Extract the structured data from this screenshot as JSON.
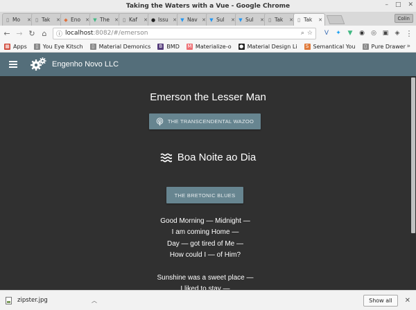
{
  "window": {
    "title": "Taking the Waters with a Vue - Google Chrome",
    "minimize": "–",
    "maximize": "□",
    "close": "✕"
  },
  "tabs": [
    {
      "label": "Mo",
      "fav": "▯",
      "fav_color": "#666666"
    },
    {
      "label": "Tak",
      "fav": "▯",
      "fav_color": "#666666"
    },
    {
      "label": "Eno",
      "fav": "◆",
      "fav_color": "#e0703a"
    },
    {
      "label": "The",
      "fav": "▼",
      "fav_color": "#41b883"
    },
    {
      "label": "Kaf",
      "fav": "▯",
      "fav_color": "#666666"
    },
    {
      "label": "Issu",
      "fav": "●",
      "fav_color": "#222222"
    },
    {
      "label": "Nav",
      "fav": "▼",
      "fav_color": "#2196f3"
    },
    {
      "label": "Sul",
      "fav": "▼",
      "fav_color": "#2196f3"
    },
    {
      "label": "Sul",
      "fav": "▼",
      "fav_color": "#2196f3"
    },
    {
      "label": "Tak",
      "fav": "▯",
      "fav_color": "#666666"
    },
    {
      "label": "Tak",
      "fav": "▯",
      "fav_color": "#666666",
      "active": true
    }
  ],
  "tab_close": "✕",
  "profile_label": "Colin",
  "toolbar": {
    "back": "←",
    "forward": "→",
    "reload": "↻",
    "home": "⌂",
    "url_host": "localhost",
    "url_path": ":8082/#/emerson",
    "info_icon": "ⓘ",
    "zoom_icon": "⌕",
    "star_icon": "☆",
    "menu_icon": "⋮"
  },
  "extensions": [
    {
      "glyph": "V",
      "color": "#3b6db5"
    },
    {
      "glyph": "✦",
      "color": "#1da1f2"
    },
    {
      "glyph": "▼",
      "color": "#41b883"
    },
    {
      "glyph": "◉",
      "color": "#333333"
    },
    {
      "glyph": "◎",
      "color": "#555555"
    },
    {
      "glyph": "▣",
      "color": "#444444"
    },
    {
      "glyph": "◈",
      "color": "#555555"
    }
  ],
  "bookmarks": [
    {
      "label": "Apps",
      "icon": "▦",
      "icon_bg": "#d04a3a"
    },
    {
      "label": "You Eye Kitsch",
      "icon": "▯",
      "icon_bg": "#888888"
    },
    {
      "label": "Material Demonics",
      "icon": "▯",
      "icon_bg": "#888888"
    },
    {
      "label": "BMD",
      "icon": "B",
      "icon_bg": "#563d7c"
    },
    {
      "label": "Materialize-o",
      "icon": "M",
      "icon_bg": "#ee6e73"
    },
    {
      "label": "Material Design Li",
      "icon": "●",
      "icon_bg": "#222222"
    },
    {
      "label": "Semantical You",
      "icon": "S",
      "icon_bg": "#e07a3a"
    },
    {
      "label": "Pure Drawer",
      "icon": "▯",
      "icon_bg": "#888888"
    }
  ],
  "bookmarks_more": "»",
  "app": {
    "bar_color": "#546e7a",
    "background": "#303030",
    "brand": "Engenho Novo LLC"
  },
  "page": {
    "title": "Emerson the Lesser Man",
    "button1": "The Transcendental Wazoo",
    "poem_title": "Boa Noite ao Dia",
    "button2": "The Bretonic Blues",
    "stanza1": [
      "Good Morning — Midnight —",
      "I am coming Home —",
      "Day — got tired of Me —",
      "How could I — of Him?"
    ],
    "stanza2": [
      "Sunshine was a sweet place —",
      "I liked to stay —"
    ]
  },
  "downloads": {
    "filename": "zipster.jpg",
    "show_all": "Show all",
    "close": "✕"
  }
}
